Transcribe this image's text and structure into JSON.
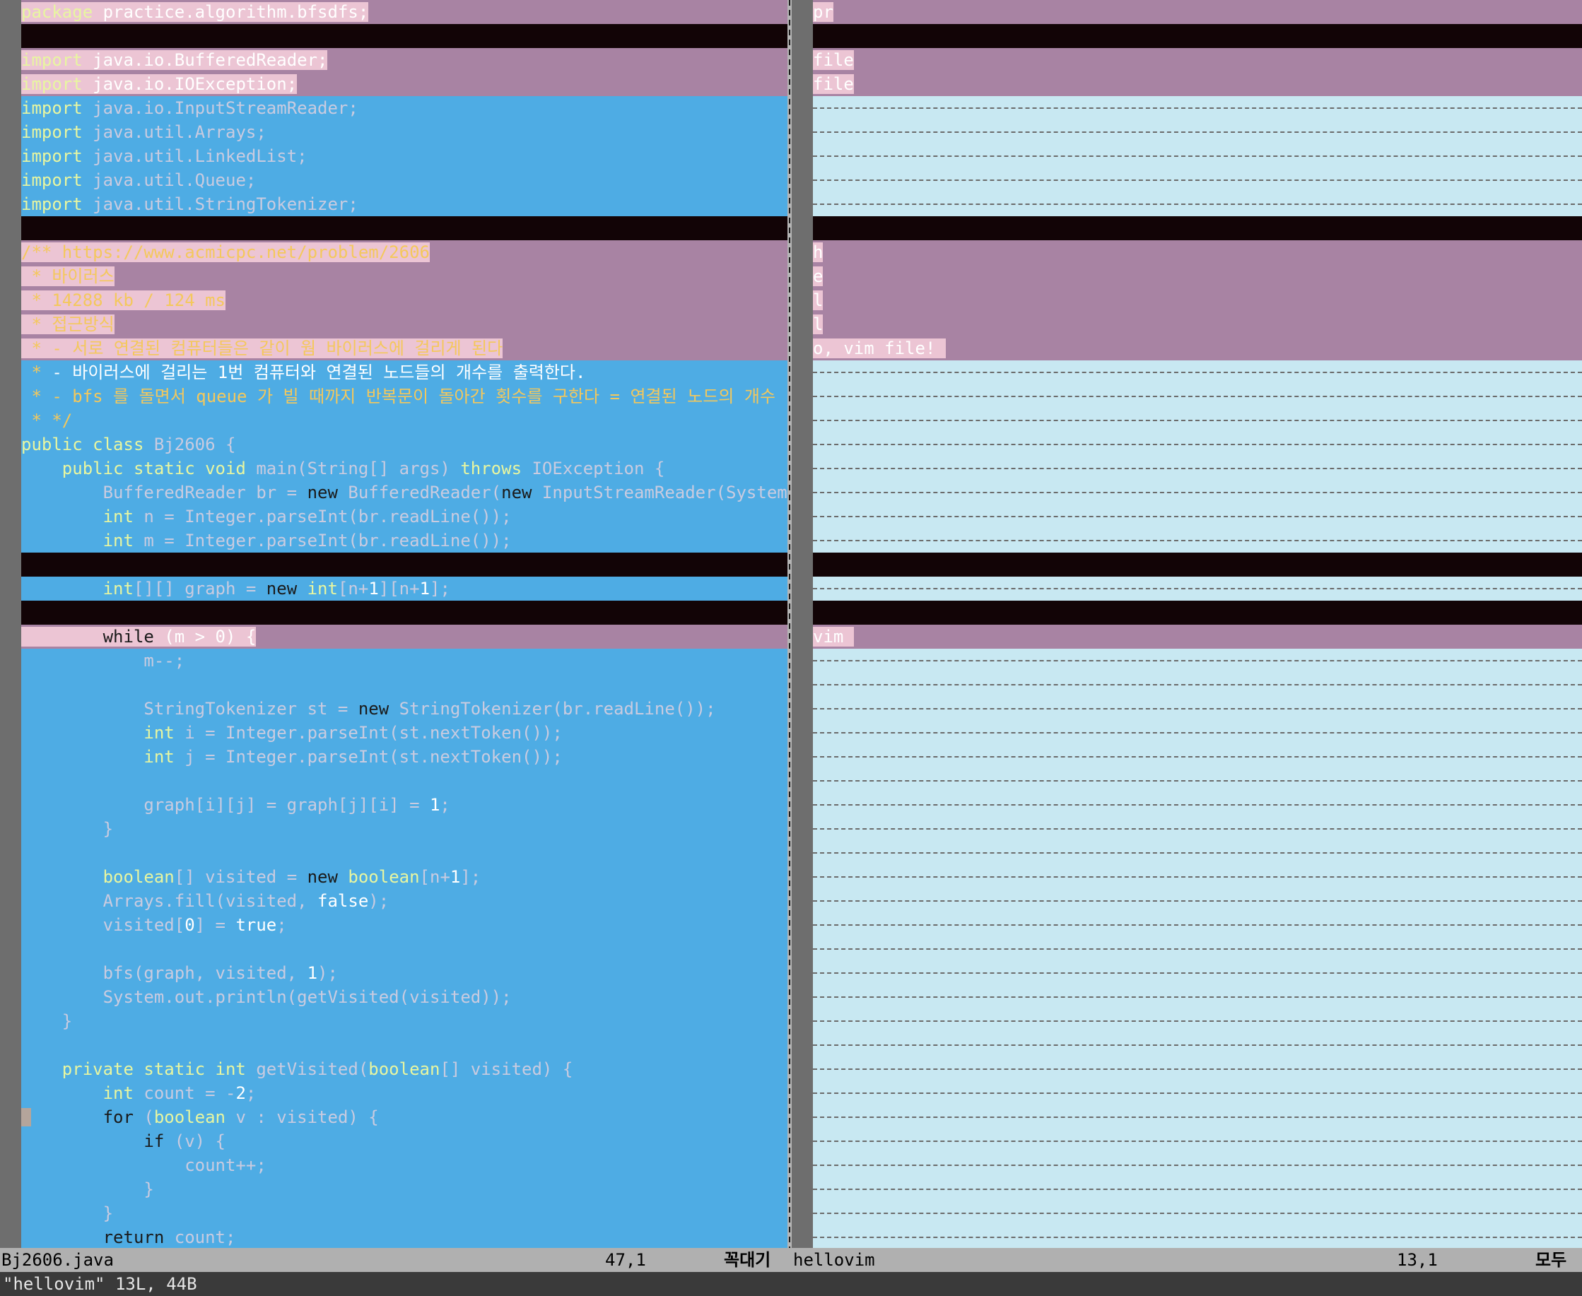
{
  "left_lines": [
    {
      "type": "change",
      "parts": [
        {
          "t": "package",
          "c": "seg-text kw-green"
        },
        {
          "t": " practice.algorithm.bfsdfs;",
          "c": "seg-text"
        }
      ]
    },
    {
      "type": "blank",
      "parts": []
    },
    {
      "type": "change",
      "parts": [
        {
          "t": "import",
          "c": "seg-text kw-green"
        },
        {
          "t": " java.io.BufferedReader;",
          "c": "seg-text"
        }
      ]
    },
    {
      "type": "change",
      "parts": [
        {
          "t": "import",
          "c": "seg-text kw-green"
        },
        {
          "t": " java.io.IOException;",
          "c": "seg-text"
        }
      ]
    },
    {
      "type": "add",
      "parts": [
        {
          "t": "import",
          "c": "kw-green"
        },
        {
          "t": " java.io.InputStreamReader;",
          "c": "muted"
        }
      ]
    },
    {
      "type": "add",
      "parts": [
        {
          "t": "import",
          "c": "kw-green"
        },
        {
          "t": " java.util.Arrays;",
          "c": "muted"
        }
      ]
    },
    {
      "type": "add",
      "parts": [
        {
          "t": "import",
          "c": "kw-green"
        },
        {
          "t": " java.util.LinkedList;",
          "c": "muted"
        }
      ]
    },
    {
      "type": "add",
      "parts": [
        {
          "t": "import",
          "c": "kw-green"
        },
        {
          "t": " java.util.Queue;",
          "c": "muted"
        }
      ]
    },
    {
      "type": "add",
      "parts": [
        {
          "t": "import",
          "c": "kw-green"
        },
        {
          "t": " java.util.StringTokenizer;",
          "c": "muted"
        }
      ]
    },
    {
      "type": "blank",
      "parts": []
    },
    {
      "type": "change",
      "parts": [
        {
          "t": "/** https://www.acmicpc.net/problem/2606",
          "c": "seg-text cm-orange"
        }
      ]
    },
    {
      "type": "change",
      "parts": [
        {
          "t": " * 바이러스",
          "c": "seg-text cm-orange"
        }
      ]
    },
    {
      "type": "change",
      "parts": [
        {
          "t": " * 14288 kb / 124 ms",
          "c": "seg-text cm-orange"
        }
      ]
    },
    {
      "type": "change",
      "parts": [
        {
          "t": " * 접근방식",
          "c": "seg-text cm-orange"
        }
      ]
    },
    {
      "type": "change",
      "parts": [
        {
          "t": " * - 서로 연결된 컴퓨터들은 같이 웜 바이러스에 걸리게 된다",
          "c": "seg-text cm-orange"
        }
      ]
    },
    {
      "type": "add",
      "parts": [
        {
          "t": " * ",
          "c": "cm-orange"
        },
        {
          "t": "- 바이러스에 걸리는 1번 컴퓨터와 연결된 노드들의 개수를 출력한다.",
          "c": "cm-white"
        }
      ]
    },
    {
      "type": "add",
      "parts": [
        {
          "t": " * - bfs 를 돌면서 queue 가 빌 때까지 반복문이 돌아간 횟수를 구한다 = 연결된 노드의 개수",
          "c": "cm-orange"
        }
      ]
    },
    {
      "type": "add",
      "parts": [
        {
          "t": " * */",
          "c": "cm-orange"
        }
      ]
    },
    {
      "type": "add",
      "parts": [
        {
          "t": "public class",
          "c": "kw-green"
        },
        {
          "t": " Bj2606 {",
          "c": "muted"
        }
      ]
    },
    {
      "type": "add",
      "parts": [
        {
          "t": "    public static void",
          "c": "kw-green"
        },
        {
          "t": " main(String[] args) ",
          "c": "muted"
        },
        {
          "t": "throws",
          "c": "kw-green"
        },
        {
          "t": " IOException {",
          "c": "muted"
        }
      ]
    },
    {
      "type": "add",
      "parts": [
        {
          "t": "        BufferedReader br = ",
          "c": "muted"
        },
        {
          "t": "new",
          "c": "kw-dark"
        },
        {
          "t": " BufferedReader(",
          "c": "muted"
        },
        {
          "t": "new",
          "c": "kw-dark"
        },
        {
          "t": " InputStreamReader(System.in));",
          "c": "muted"
        }
      ]
    },
    {
      "type": "add",
      "parts": [
        {
          "t": "        int",
          "c": "kw-green"
        },
        {
          "t": " n = Integer.parseInt(br.readLine());",
          "c": "muted"
        }
      ]
    },
    {
      "type": "add",
      "parts": [
        {
          "t": "        int",
          "c": "kw-green"
        },
        {
          "t": " m = Integer.parseInt(br.readLine());",
          "c": "muted"
        }
      ]
    },
    {
      "type": "blank",
      "parts": []
    },
    {
      "type": "add",
      "parts": [
        {
          "t": "        int",
          "c": "kw-green"
        },
        {
          "t": "[][] graph = ",
          "c": "muted"
        },
        {
          "t": "new",
          "c": "kw-dark"
        },
        {
          "t": " int",
          "c": "kw-green"
        },
        {
          "t": "[n+",
          "c": "muted"
        },
        {
          "t": "1",
          "c": "num"
        },
        {
          "t": "][n+",
          "c": "muted"
        },
        {
          "t": "1",
          "c": "num"
        },
        {
          "t": "];",
          "c": "muted"
        }
      ]
    },
    {
      "type": "blank",
      "parts": []
    },
    {
      "type": "change",
      "parts": [
        {
          "t": "        while",
          "c": "seg-text kw-dark"
        },
        {
          "t": " (m > 0) {",
          "c": "seg-text"
        }
      ]
    },
    {
      "type": "add",
      "parts": [
        {
          "t": "            m--;",
          "c": "muted"
        }
      ]
    },
    {
      "type": "add",
      "parts": [
        {
          "t": "",
          "c": "muted"
        }
      ]
    },
    {
      "type": "add",
      "parts": [
        {
          "t": "            StringTokenizer st = ",
          "c": "muted"
        },
        {
          "t": "new",
          "c": "kw-dark"
        },
        {
          "t": " StringTokenizer(br.readLine());",
          "c": "muted"
        }
      ]
    },
    {
      "type": "add",
      "parts": [
        {
          "t": "            int",
          "c": "kw-green"
        },
        {
          "t": " i = Integer.parseInt(st.nextToken());",
          "c": "muted"
        }
      ]
    },
    {
      "type": "add",
      "parts": [
        {
          "t": "            int",
          "c": "kw-green"
        },
        {
          "t": " j = Integer.parseInt(st.nextToken());",
          "c": "muted"
        }
      ]
    },
    {
      "type": "add",
      "parts": [
        {
          "t": "",
          "c": "muted"
        }
      ]
    },
    {
      "type": "add",
      "parts": [
        {
          "t": "            graph[i][j] = graph[j][i] = ",
          "c": "muted"
        },
        {
          "t": "1",
          "c": "num"
        },
        {
          "t": ";",
          "c": "muted"
        }
      ]
    },
    {
      "type": "add",
      "parts": [
        {
          "t": "        }",
          "c": "muted"
        }
      ]
    },
    {
      "type": "add",
      "parts": [
        {
          "t": "",
          "c": "muted"
        }
      ]
    },
    {
      "type": "add",
      "parts": [
        {
          "t": "        boolean",
          "c": "kw-green"
        },
        {
          "t": "[] visited = ",
          "c": "muted"
        },
        {
          "t": "new",
          "c": "kw-dark"
        },
        {
          "t": " boolean",
          "c": "kw-green"
        },
        {
          "t": "[n+",
          "c": "muted"
        },
        {
          "t": "1",
          "c": "num"
        },
        {
          "t": "];",
          "c": "muted"
        }
      ]
    },
    {
      "type": "add",
      "parts": [
        {
          "t": "        Arrays.fill(visited, ",
          "c": "muted"
        },
        {
          "t": "false",
          "c": "kw-white"
        },
        {
          "t": ");",
          "c": "muted"
        }
      ]
    },
    {
      "type": "add",
      "parts": [
        {
          "t": "        visited[",
          "c": "muted"
        },
        {
          "t": "0",
          "c": "num"
        },
        {
          "t": "] = ",
          "c": "muted"
        },
        {
          "t": "true",
          "c": "kw-white"
        },
        {
          "t": ";",
          "c": "muted"
        }
      ]
    },
    {
      "type": "add",
      "parts": [
        {
          "t": "",
          "c": "muted"
        }
      ]
    },
    {
      "type": "add",
      "parts": [
        {
          "t": "        bfs(graph, visited, ",
          "c": "muted"
        },
        {
          "t": "1",
          "c": "num"
        },
        {
          "t": ");",
          "c": "muted"
        }
      ]
    },
    {
      "type": "add",
      "parts": [
        {
          "t": "        System.out.println(getVisited(visited));",
          "c": "muted"
        }
      ]
    },
    {
      "type": "add",
      "parts": [
        {
          "t": "    }",
          "c": "muted"
        }
      ]
    },
    {
      "type": "add",
      "parts": [
        {
          "t": "",
          "c": "muted"
        }
      ]
    },
    {
      "type": "add",
      "parts": [
        {
          "t": "    private static int",
          "c": "kw-green"
        },
        {
          "t": " getVisited(",
          "c": "muted"
        },
        {
          "t": "boolean",
          "c": "kw-green"
        },
        {
          "t": "[] visited) {",
          "c": "muted"
        }
      ]
    },
    {
      "type": "add",
      "parts": [
        {
          "t": "        int",
          "c": "kw-green"
        },
        {
          "t": " count = -",
          "c": "muted"
        },
        {
          "t": "2",
          "c": "num"
        },
        {
          "t": ";",
          "c": "muted"
        }
      ]
    },
    {
      "type": "add",
      "cursor": true,
      "parts": [
        {
          "t": "        for",
          "c": "kw-dark"
        },
        {
          "t": " (",
          "c": "muted"
        },
        {
          "t": "boolean",
          "c": "kw-green"
        },
        {
          "t": " v : visited) {",
          "c": "muted"
        }
      ]
    },
    {
      "type": "add",
      "parts": [
        {
          "t": "            if",
          "c": "kw-dark"
        },
        {
          "t": " (v) {",
          "c": "muted"
        }
      ]
    },
    {
      "type": "add",
      "parts": [
        {
          "t": "                count++;",
          "c": "muted"
        }
      ]
    },
    {
      "type": "add",
      "parts": [
        {
          "t": "            }",
          "c": "muted"
        }
      ]
    },
    {
      "type": "add",
      "parts": [
        {
          "t": "        }",
          "c": "muted"
        }
      ]
    },
    {
      "type": "add",
      "parts": [
        {
          "t": "        return",
          "c": "kw-dark"
        },
        {
          "t": " count;",
          "c": "muted"
        }
      ]
    }
  ],
  "right_lines": [
    {
      "type": "change",
      "parts": [
        {
          "t": "pr",
          "c": "seg-text"
        }
      ]
    },
    {
      "type": "blank",
      "parts": []
    },
    {
      "type": "change",
      "parts": [
        {
          "t": "file",
          "c": "seg-text"
        }
      ]
    },
    {
      "type": "change",
      "parts": [
        {
          "t": "file",
          "c": "seg-text"
        }
      ]
    },
    {
      "type": "filler",
      "parts": []
    },
    {
      "type": "filler",
      "parts": []
    },
    {
      "type": "filler",
      "parts": []
    },
    {
      "type": "filler",
      "parts": []
    },
    {
      "type": "filler",
      "parts": []
    },
    {
      "type": "blank",
      "parts": []
    },
    {
      "type": "change",
      "parts": [
        {
          "t": "h",
          "c": "seg-text"
        }
      ]
    },
    {
      "type": "change",
      "parts": [
        {
          "t": "e",
          "c": "seg-text"
        }
      ]
    },
    {
      "type": "change",
      "parts": [
        {
          "t": "l",
          "c": "seg-text"
        }
      ]
    },
    {
      "type": "change",
      "parts": [
        {
          "t": "l",
          "c": "seg-text"
        }
      ]
    },
    {
      "type": "change",
      "parts": [
        {
          "t": "o, vim file! ",
          "c": "seg-text"
        }
      ]
    },
    {
      "type": "filler",
      "parts": []
    },
    {
      "type": "filler",
      "parts": []
    },
    {
      "type": "filler",
      "parts": []
    },
    {
      "type": "filler",
      "parts": []
    },
    {
      "type": "filler",
      "parts": []
    },
    {
      "type": "filler",
      "parts": []
    },
    {
      "type": "filler",
      "parts": []
    },
    {
      "type": "filler",
      "parts": []
    },
    {
      "type": "blank",
      "parts": []
    },
    {
      "type": "filler",
      "parts": []
    },
    {
      "type": "blank",
      "parts": []
    },
    {
      "type": "change",
      "parts": [
        {
          "t": "vim ",
          "c": "seg-text"
        }
      ]
    },
    {
      "type": "filler",
      "parts": []
    },
    {
      "type": "filler",
      "parts": []
    },
    {
      "type": "filler",
      "parts": []
    },
    {
      "type": "filler",
      "parts": []
    },
    {
      "type": "filler",
      "parts": []
    },
    {
      "type": "filler",
      "parts": []
    },
    {
      "type": "filler",
      "parts": []
    },
    {
      "type": "filler",
      "parts": []
    },
    {
      "type": "filler",
      "parts": []
    },
    {
      "type": "filler",
      "parts": []
    },
    {
      "type": "filler",
      "parts": []
    },
    {
      "type": "filler",
      "parts": []
    },
    {
      "type": "filler",
      "parts": []
    },
    {
      "type": "filler",
      "parts": []
    },
    {
      "type": "filler",
      "parts": []
    },
    {
      "type": "filler",
      "parts": []
    },
    {
      "type": "filler",
      "parts": []
    },
    {
      "type": "filler",
      "parts": []
    },
    {
      "type": "filler",
      "parts": []
    },
    {
      "type": "filler",
      "parts": []
    },
    {
      "type": "filler",
      "parts": []
    },
    {
      "type": "filler",
      "parts": []
    },
    {
      "type": "filler",
      "parts": []
    },
    {
      "type": "filler",
      "parts": []
    },
    {
      "type": "filler",
      "parts": []
    },
    {
      "type": "filler",
      "parts": []
    }
  ],
  "status": {
    "left_file": "Bj2606.java",
    "left_pos": "47,1",
    "left_scroll": "꼭대기",
    "right_file": "hellovim",
    "right_pos": "13,1",
    "right_scroll": "모두"
  },
  "command_line": "\"hellovim\" 13L, 44B",
  "colors": {
    "diff_change": "#a883a3",
    "diff_text": "#ecc5d4",
    "diff_add": "#4eace4",
    "diff_filler": "#c8e8f2",
    "separator": "#120406"
  }
}
